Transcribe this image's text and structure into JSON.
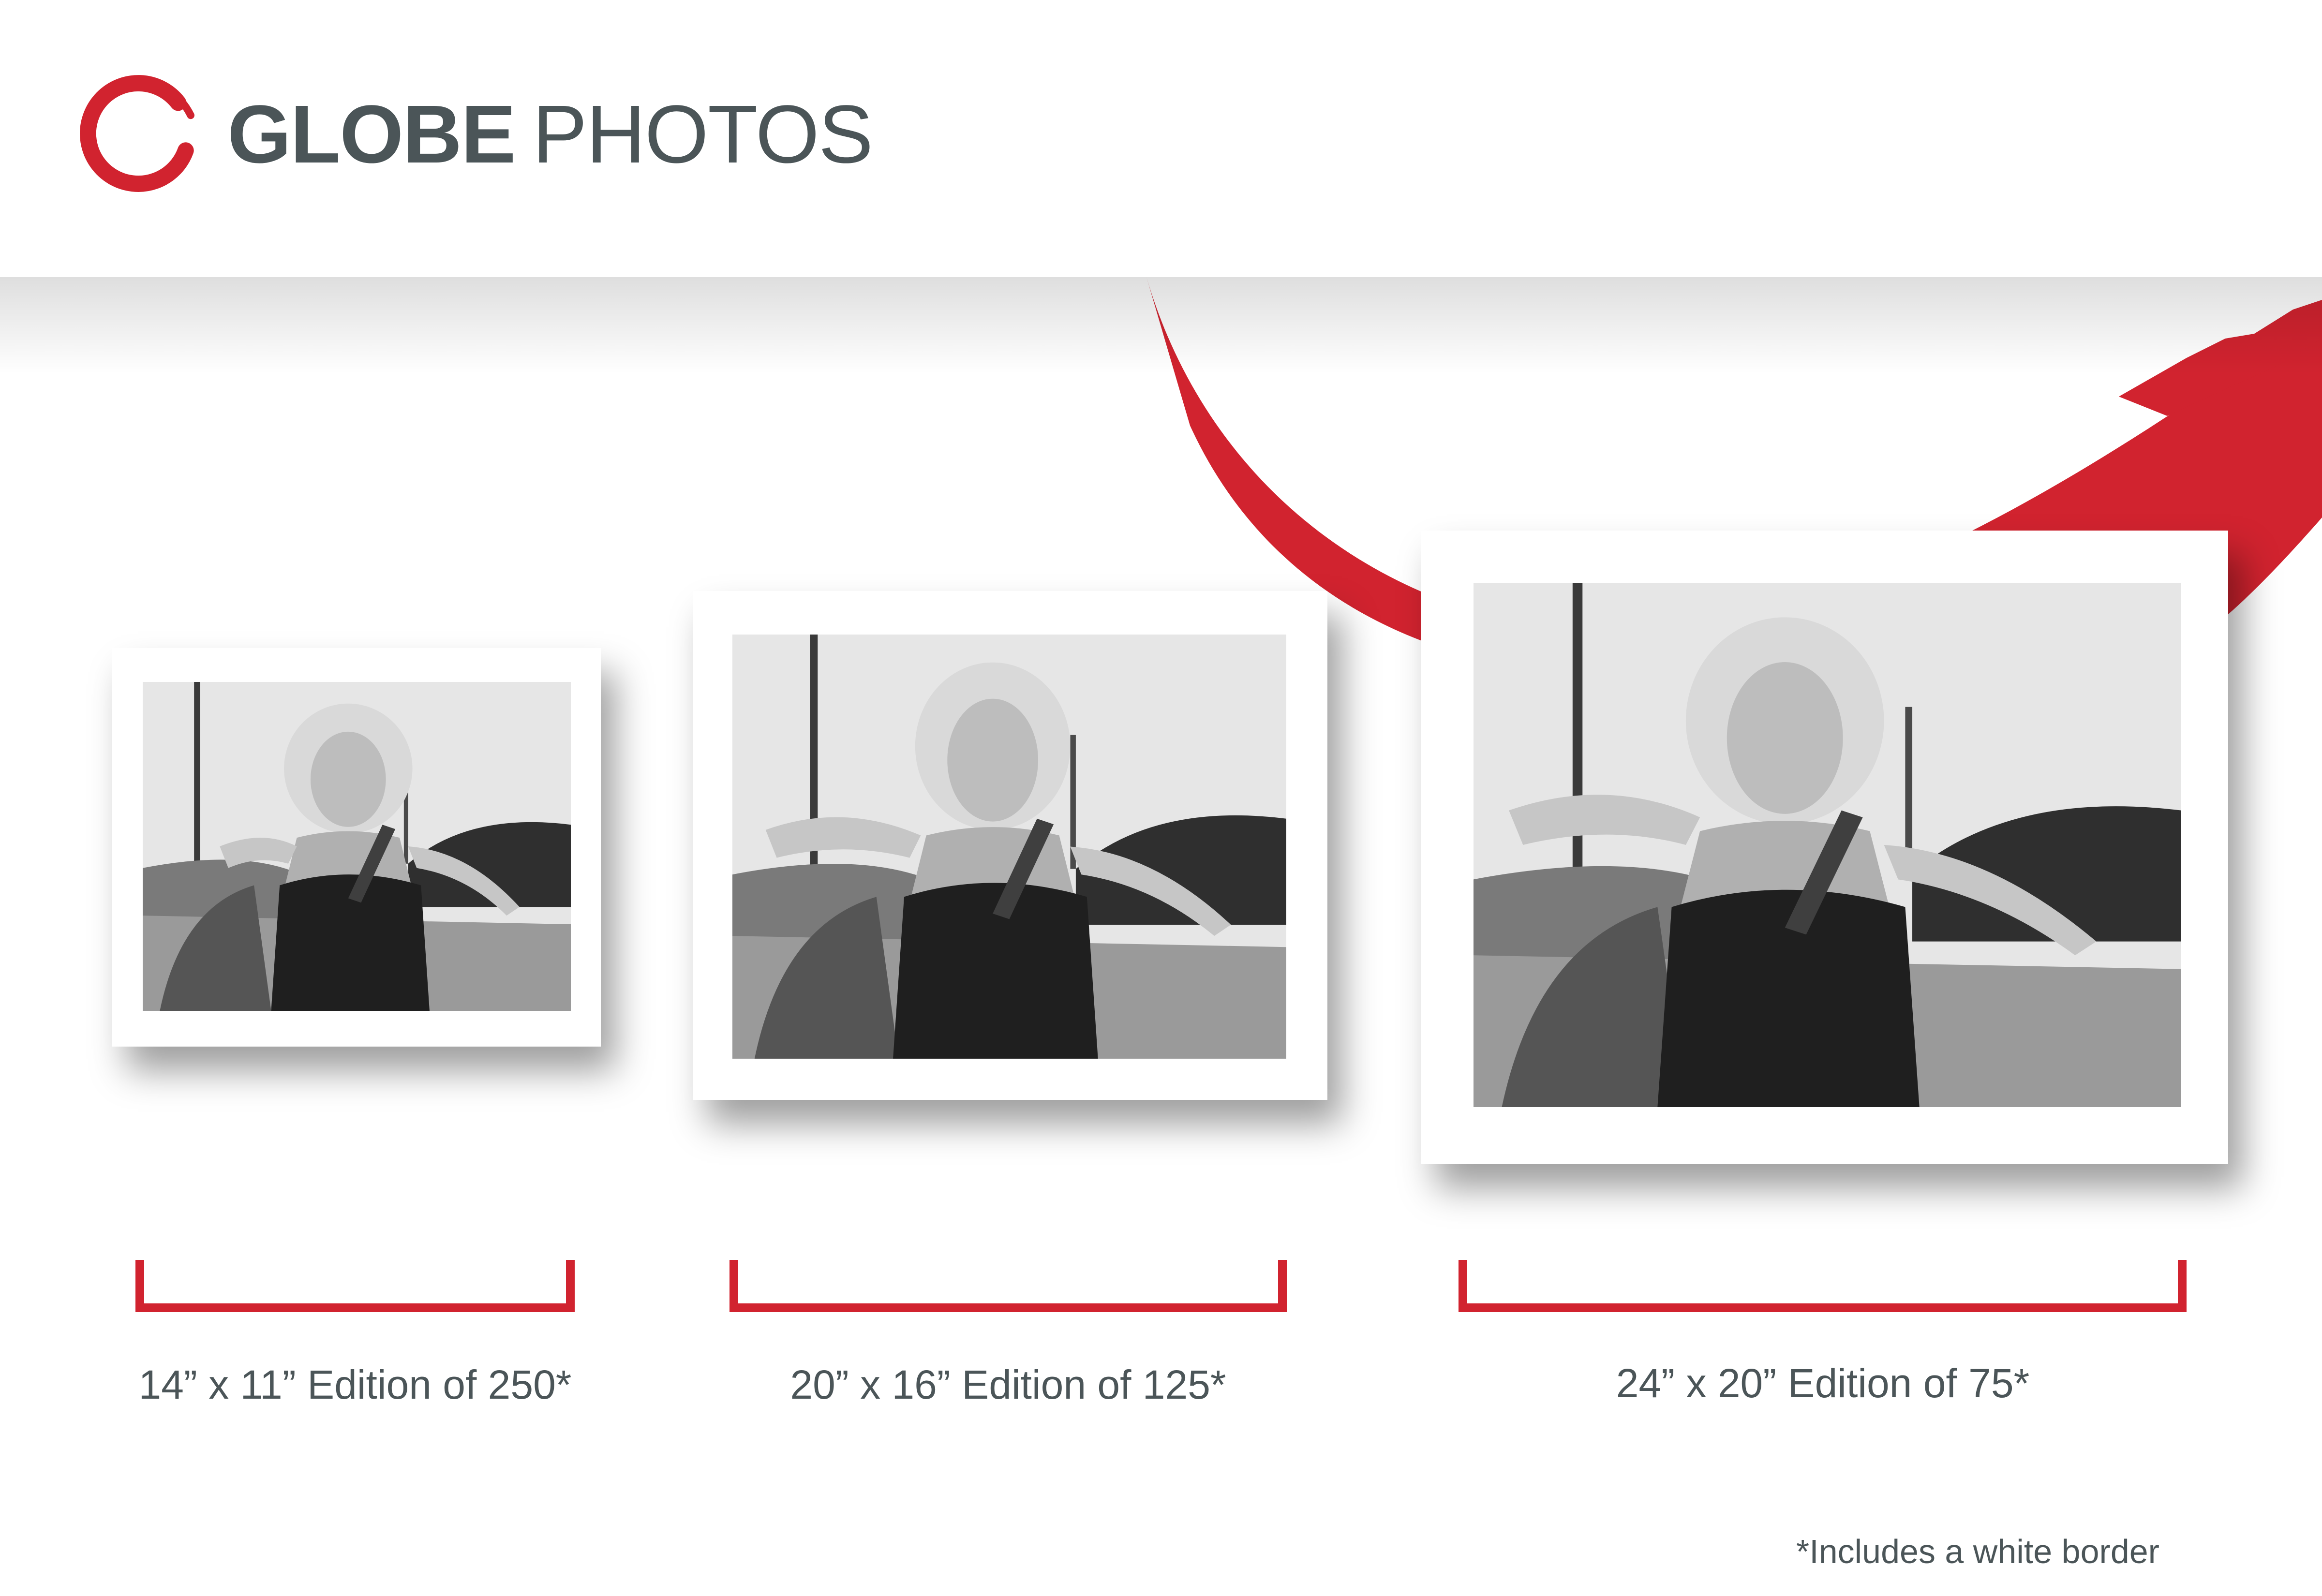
{
  "brand": {
    "name_bold": "GLOBE",
    "name_regular": "PHOTOS",
    "logo_icon": "brush-circle-logo-icon"
  },
  "colors": {
    "accent": "#d1232f",
    "text": "#4b5558",
    "background": "#ffffff"
  },
  "editions": [
    {
      "caption": "14” x 11” Edition of 250*"
    },
    {
      "caption": "20” x 16” Edition of 125*"
    },
    {
      "caption": "24” x 20” Edition of 75*"
    }
  ],
  "footnote": "*Includes a white border"
}
